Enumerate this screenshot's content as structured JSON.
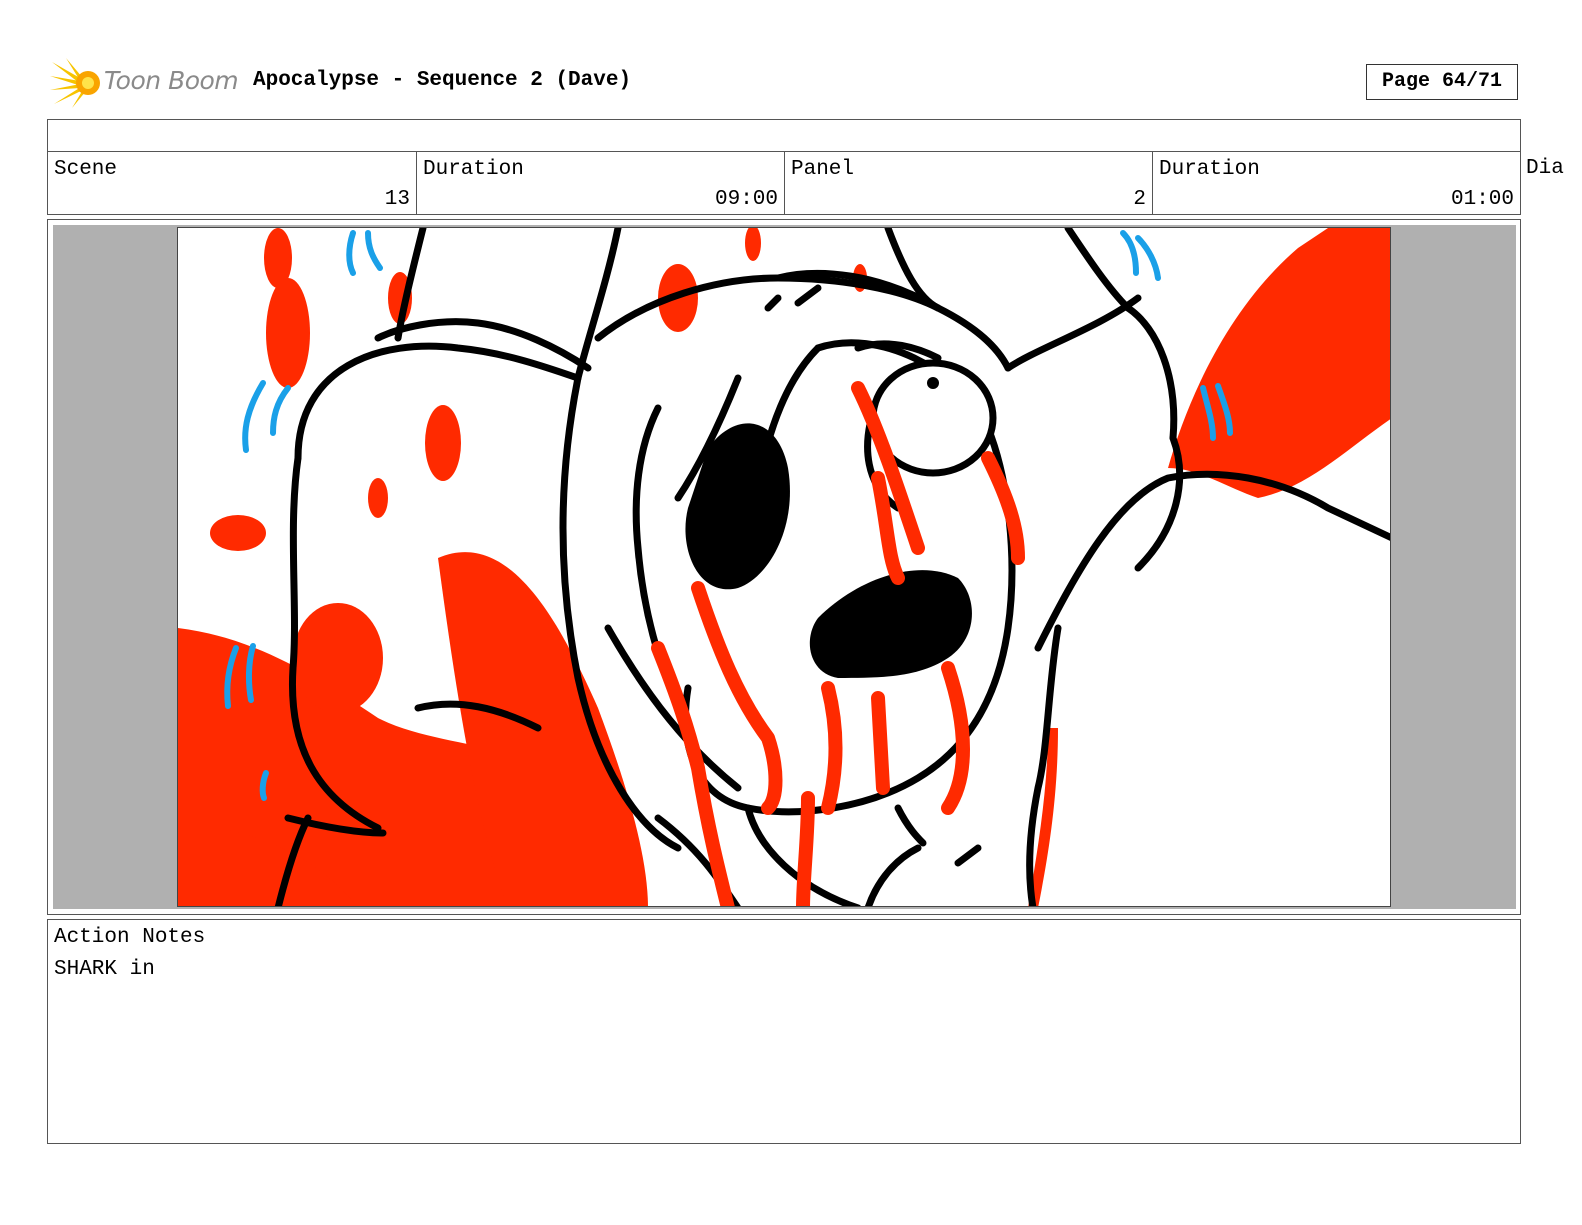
{
  "header": {
    "logo_text": "Toon Boom",
    "title": "Apocalypse - Sequence 2 (Dave)",
    "page_label": "Page 64/71"
  },
  "info_row": {
    "scene_label": "Scene",
    "scene_value": "13",
    "scene_duration_label": "Duration",
    "scene_duration_value": "09:00",
    "panel_label": "Panel",
    "panel_value": "2",
    "panel_duration_label": "Duration",
    "panel_duration_value": "01:00",
    "dialogue_label": "Dia"
  },
  "panel_image": {
    "description_icon": "storyboard-sketch",
    "colors": {
      "ink": "#000000",
      "blood": "#ff2a00",
      "shake_lines": "#1aa0e8",
      "letterbox": "#b0b0b0"
    }
  },
  "notes": {
    "label": "Action Notes",
    "text": "SHARK in"
  }
}
